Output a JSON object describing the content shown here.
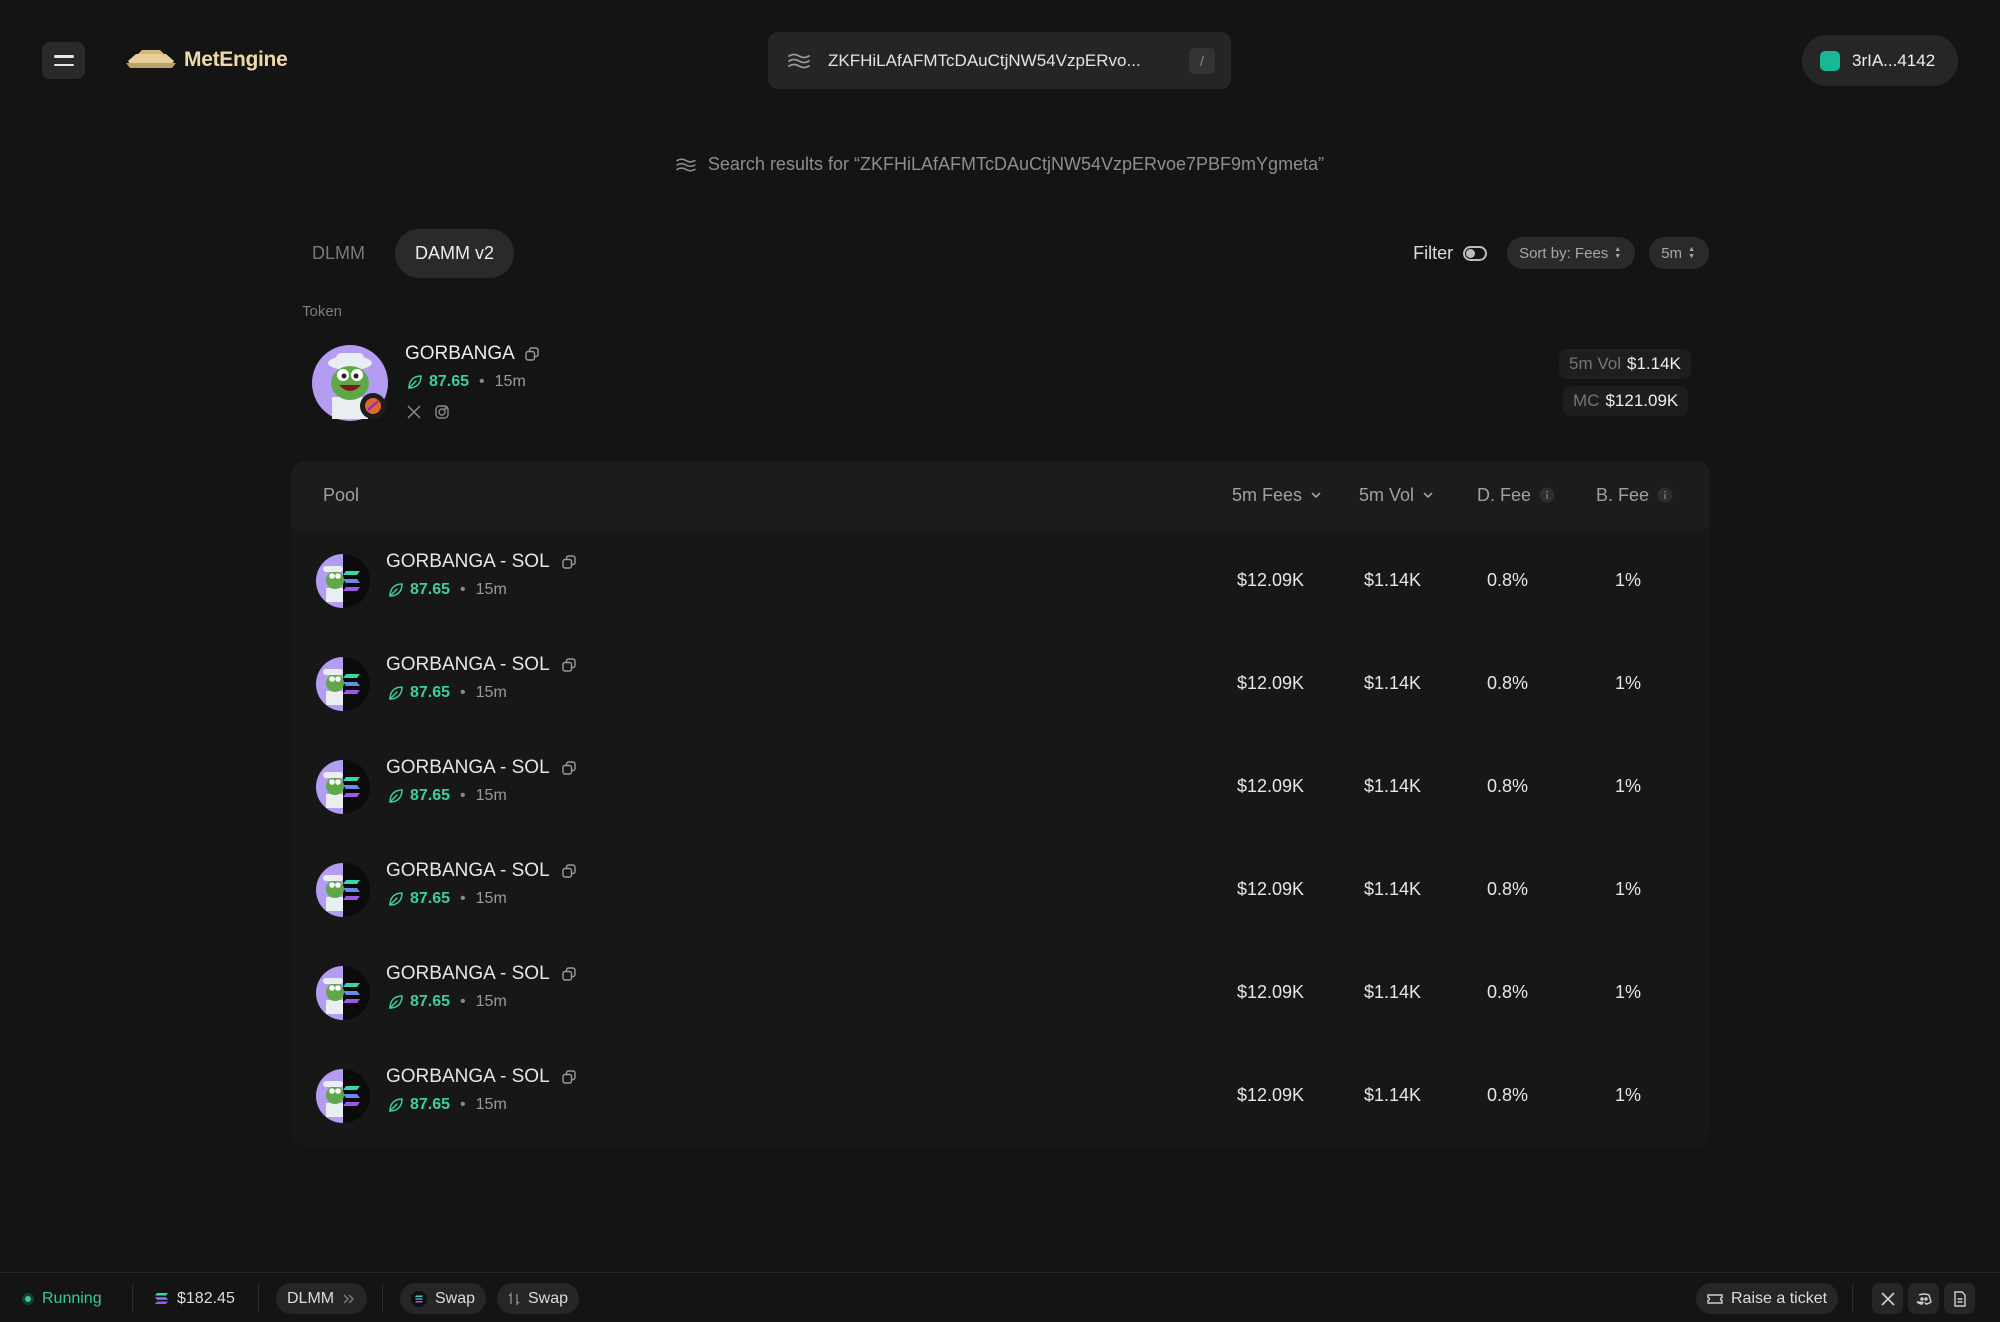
{
  "header": {
    "brand": "MetEngine",
    "search": {
      "value": "ZKFHiLAfAFMTcDAuCtjNW54VzpERvo...",
      "shortcut": "/"
    },
    "wallet": "3rIA...4142"
  },
  "results_caption": "Search results for “ZKFHiLAfAFMTcDAuCtjNW54VzpERvoe7PBF9mYgmeta”",
  "tabs": [
    {
      "label": "DLMM",
      "active": false
    },
    {
      "label": "DAMM v2",
      "active": true
    }
  ],
  "controls": {
    "filter_label": "Filter",
    "sort_label": "Sort by: Fees",
    "timeframe": "5m"
  },
  "token": {
    "section_label": "Token",
    "name": "GORBANGA",
    "score": "87.65",
    "age": "15m",
    "vol_label": "5m Vol",
    "vol_value": "$1.14K",
    "mc_label": "MC",
    "mc_value": "$121.09K"
  },
  "table": {
    "headers": {
      "pool": "Pool",
      "fees": "5m Fees",
      "vol": "5m Vol",
      "dfee": "D. Fee",
      "bfee": "B. Fee"
    },
    "rows": [
      {
        "pair": "GORBANGA - SOL",
        "score": "87.65",
        "age": "15m",
        "fees": "$12.09K",
        "vol": "$1.14K",
        "dfee": "0.8%",
        "bfee": "1%"
      },
      {
        "pair": "GORBANGA - SOL",
        "score": "87.65",
        "age": "15m",
        "fees": "$12.09K",
        "vol": "$1.14K",
        "dfee": "0.8%",
        "bfee": "1%"
      },
      {
        "pair": "GORBANGA - SOL",
        "score": "87.65",
        "age": "15m",
        "fees": "$12.09K",
        "vol": "$1.14K",
        "dfee": "0.8%",
        "bfee": "1%"
      },
      {
        "pair": "GORBANGA - SOL",
        "score": "87.65",
        "age": "15m",
        "fees": "$12.09K",
        "vol": "$1.14K",
        "dfee": "0.8%",
        "bfee": "1%"
      },
      {
        "pair": "GORBANGA - SOL",
        "score": "87.65",
        "age": "15m",
        "fees": "$12.09K",
        "vol": "$1.14K",
        "dfee": "0.8%",
        "bfee": "1%"
      },
      {
        "pair": "GORBANGA - SOL",
        "score": "87.65",
        "age": "15m",
        "fees": "$12.09K",
        "vol": "$1.14K",
        "dfee": "0.8%",
        "bfee": "1%"
      }
    ]
  },
  "footer": {
    "status": "Running",
    "sol_price": "$182.45",
    "dlmm": "DLMM",
    "swap1": "Swap",
    "swap2": "Swap",
    "ticket": "Raise a ticket"
  },
  "colors": {
    "accent_green": "#3ccf9e",
    "background": "#141414",
    "panel": "#171717",
    "wallet_badge": "#17b897",
    "brand_gold": "#efd9a7"
  }
}
